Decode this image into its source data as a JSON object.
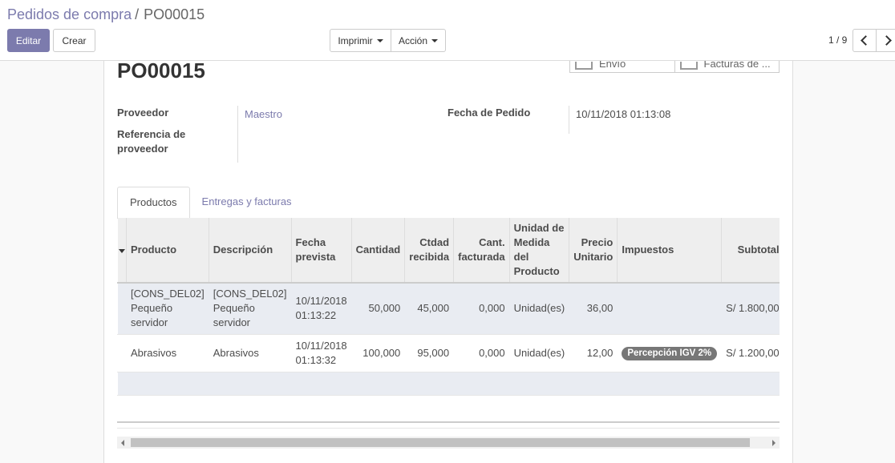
{
  "breadcrumb": {
    "parent": "Pedidos de compra",
    "separator": "/",
    "current": "PO00015"
  },
  "toolbar": {
    "edit_label": "Editar",
    "create_label": "Crear",
    "print_label": "Imprimir",
    "action_label": "Acción"
  },
  "pager": {
    "value": "1 / 9"
  },
  "smart_buttons": {
    "shipment_label": "Envío",
    "invoices_label": "Facturas de ..."
  },
  "form": {
    "title": "PO00015",
    "vendor_label": "Proveedor",
    "vendor_value": "Maestro",
    "vendor_ref_label": "Referencia de proveedor",
    "order_date_label": "Fecha de Pedido",
    "order_date_value": "10/11/2018 01:13:08"
  },
  "tabs": {
    "products": "Productos",
    "deliveries": "Entregas y facturas"
  },
  "table": {
    "headers": {
      "product": "Producto",
      "description": "Descripción",
      "date_planned": "Fecha prevista",
      "qty": "Cantidad",
      "qty_received": "Ctdad recibida",
      "qty_invoiced": "Cant. facturada",
      "uom": "Unidad de Medida del Producto",
      "price_unit": "Precio Unitario",
      "taxes": "Impuestos",
      "subtotal": "Subtotal"
    },
    "rows": [
      {
        "product": "[CONS_DEL02] Pequeño servidor",
        "description": "[CONS_DEL02] Pequeño servidor",
        "date_planned": "10/11/2018 01:13:22",
        "qty": "50,000",
        "qty_received": "45,000",
        "qty_invoiced": "0,000",
        "uom": "Unidad(es)",
        "price_unit": "36,00",
        "taxes": "",
        "subtotal": "S/ 1.800,00"
      },
      {
        "product": "Abrasivos",
        "description": "Abrasivos",
        "date_planned": "10/11/2018 01:13:32",
        "qty": "100,000",
        "qty_received": "95,000",
        "qty_invoiced": "0,000",
        "uom": "Unidad(es)",
        "price_unit": "12,00",
        "taxes": "Percepción IGV 2%",
        "subtotal": "S/ 1.200,00"
      }
    ]
  },
  "colors": {
    "brand": "#7c7bad",
    "badge": "#777777",
    "row_highlight": "#e9ecf2"
  }
}
